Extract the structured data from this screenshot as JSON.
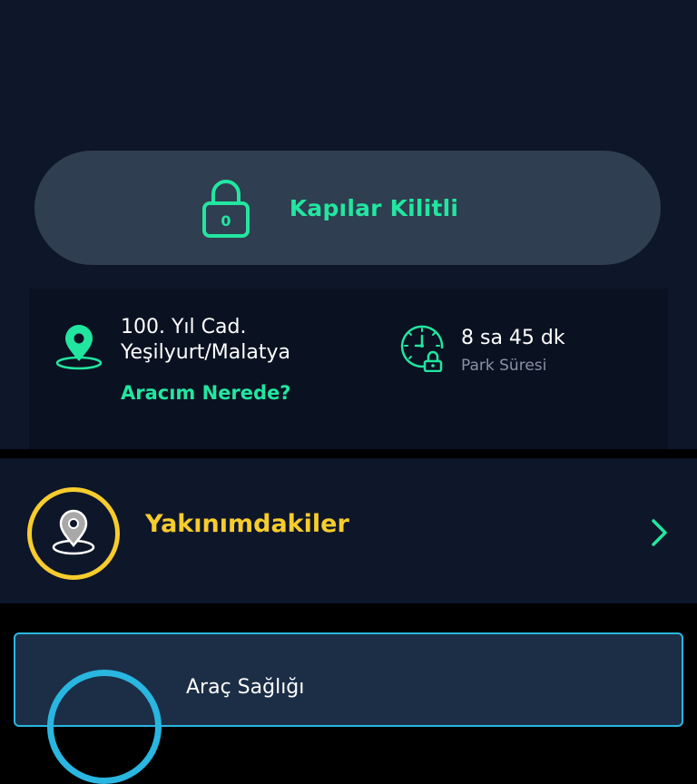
{
  "lock_status": {
    "label": "Kapılar Kilitli",
    "badge": "0",
    "icon": "padlock-icon",
    "color": "#22e6a0"
  },
  "location": {
    "address_line1": "100. Yıl Cad.",
    "address_line2": "Yeşilyurt/Malatya",
    "link_label": "Aracım Nerede?",
    "icon": "map-pin-icon"
  },
  "parking": {
    "value": "8 sa 45 dk",
    "label": "Park Süresi",
    "icon": "clock-lock-icon"
  },
  "nearby": {
    "label": "Yakınımdakiler",
    "icon": "map-pin-icon",
    "color": "#f7cc2d"
  },
  "vehicle_health": {
    "label": "Araç Sağlığı",
    "color": "#29b6e0"
  }
}
